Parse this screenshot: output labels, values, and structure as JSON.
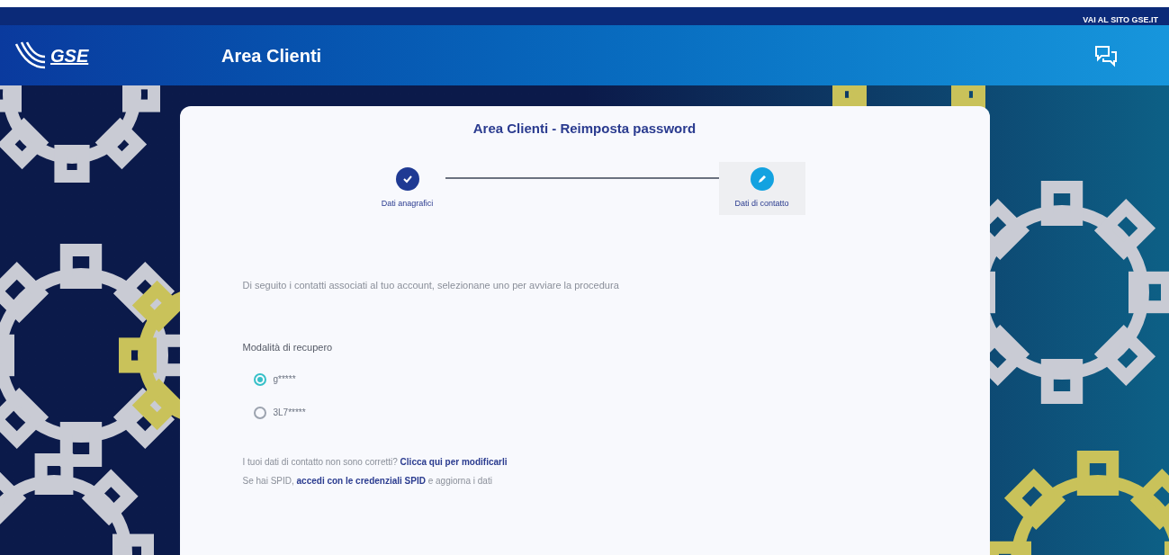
{
  "top_bar": {
    "link": "VAI AL SITO GSE.IT"
  },
  "header": {
    "logo": "GSE",
    "title": "Area Clienti"
  },
  "card": {
    "title": "Area Clienti - Reimposta password",
    "steps": [
      {
        "label": "Dati anagrafici",
        "kind": "done",
        "selected": false
      },
      {
        "label": "Dati di contatto",
        "kind": "edit",
        "selected": true
      }
    ],
    "intro": "Di seguito i contatti associati al tuo account, selezionane uno per avviare la procedura",
    "recovery": {
      "label": "Modalità di recupero",
      "options": [
        {
          "label": "g*****",
          "selected": true
        },
        {
          "label": "3L7*****",
          "selected": false
        }
      ]
    },
    "footer_lines": [
      {
        "text": "I tuoi dati di contatto non sono corretti?",
        "link": "Clicca qui per modificarli"
      },
      {
        "text": "Se hai SPID,",
        "link": "accedi con le credenziali SPID",
        "after": "e aggiorna i dati"
      }
    ]
  }
}
